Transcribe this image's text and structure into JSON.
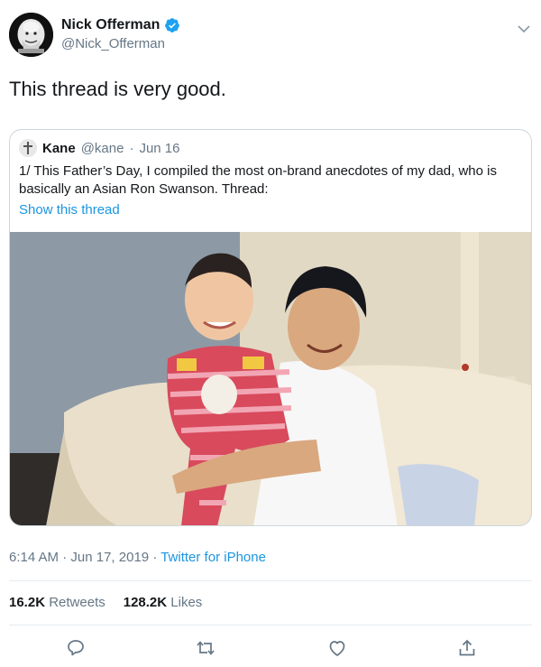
{
  "author": {
    "display_name": "Nick Offerman",
    "handle": "@Nick_Offerman",
    "verified": true,
    "avatar_icon": "woodcut-portrait-avatar"
  },
  "tweet_text": "This thread is very good.",
  "quoted_tweet": {
    "display_name": "Kane",
    "handle": "@kane",
    "separator": "·",
    "date": "Jun 16",
    "text": "1/ This Father’s Day, I compiled the most on-brand anecdotes of my dad, who is basically an Asian Ron Swanson. Thread:",
    "link_label": "Show this thread",
    "photo_icon": "father-holding-toddler-photo"
  },
  "meta": {
    "time": "6:14 AM",
    "separator": "·",
    "date": "Jun 17, 2019",
    "source": "Twitter for iPhone"
  },
  "stats": {
    "retweets_count": "16.2K",
    "retweets_label": "Retweets",
    "likes_count": "128.2K",
    "likes_label": "Likes"
  },
  "colors": {
    "link": "#1b95e0",
    "secondary_text": "#657786",
    "border": "#ccd6dd"
  },
  "icons": {
    "reply": "reply-icon",
    "retweet": "retweet-icon",
    "like": "heart-icon",
    "share": "share-icon",
    "menu": "chevron-down-icon",
    "verified": "verified-badge-icon"
  }
}
